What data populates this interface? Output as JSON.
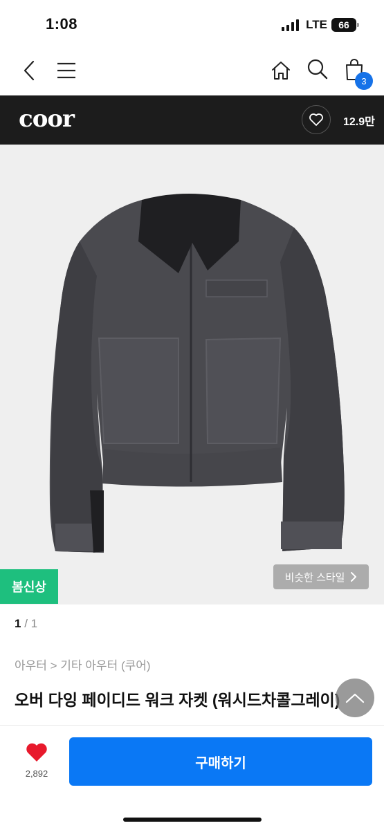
{
  "status": {
    "time": "1:08",
    "network": "LTE",
    "battery": "66"
  },
  "nav": {
    "cart_count": "3"
  },
  "brand": {
    "logo": "coor",
    "like_count": "12.9만"
  },
  "gallery": {
    "badge": "봄신상",
    "similar_style": "비슷한 스타일",
    "current_page": "1",
    "total_pages": "1"
  },
  "product": {
    "breadcrumb": "아우터 > 기타 아우터 (쿠어)",
    "title": "오버 다잉 페이디드 워크 자켓 (워시드차콜그레이)"
  },
  "actions": {
    "like_count": "2,892",
    "buy_label": "구매하기"
  },
  "colors": {
    "accent": "#0a78f5",
    "badge_blue": "#1672e8",
    "new_badge": "#1ebf7e",
    "like_red": "#e8192c",
    "brand_bar": "#1c1c1c"
  }
}
